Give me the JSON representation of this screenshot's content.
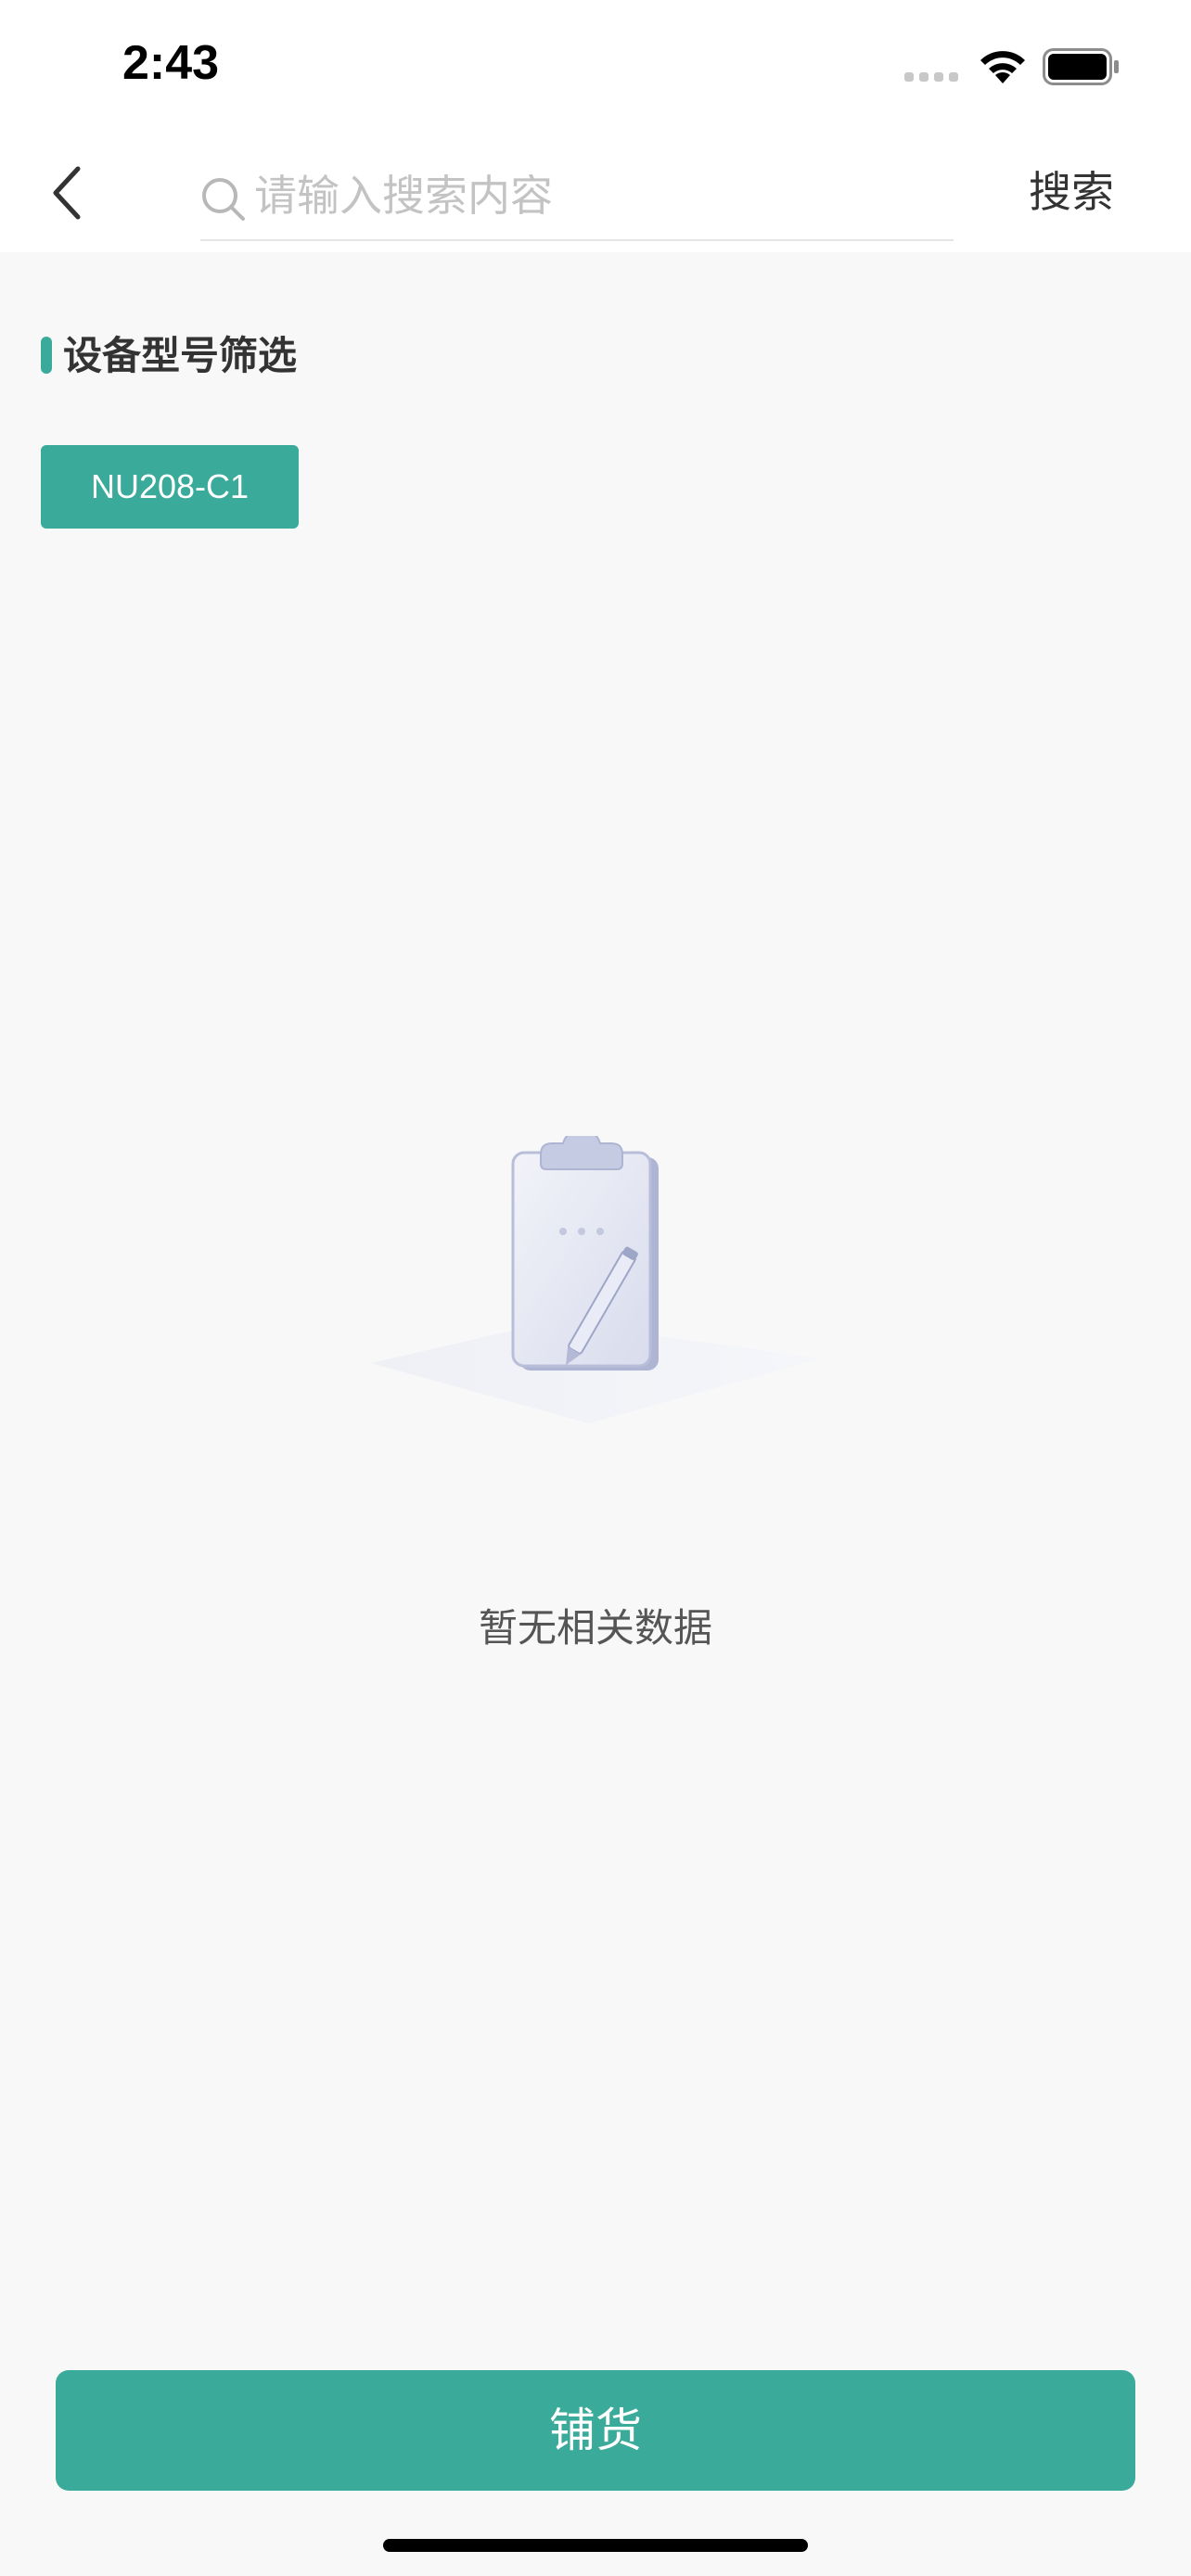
{
  "status_bar": {
    "time": "2:43",
    "icons": [
      "signal-icon",
      "wifi-icon",
      "battery-icon"
    ]
  },
  "nav": {
    "back_icon": "chevron-left-icon",
    "search_icon": "search-icon",
    "search_placeholder": "请输入搜索内容",
    "search_value": "",
    "search_button": "搜索"
  },
  "filter": {
    "title": "设备型号筛选",
    "chips": [
      {
        "label": "NU208-C1",
        "selected": true
      }
    ]
  },
  "empty_state": {
    "icon": "clipboard-pencil-illustration",
    "text": "暂无相关数据"
  },
  "actions": {
    "primary_label": "铺货"
  },
  "colors": {
    "accent": "#3aab9a",
    "background": "#f8f8f8",
    "header_background": "#ffffff",
    "placeholder": "#c3c3c3",
    "text_primary": "#333333"
  }
}
